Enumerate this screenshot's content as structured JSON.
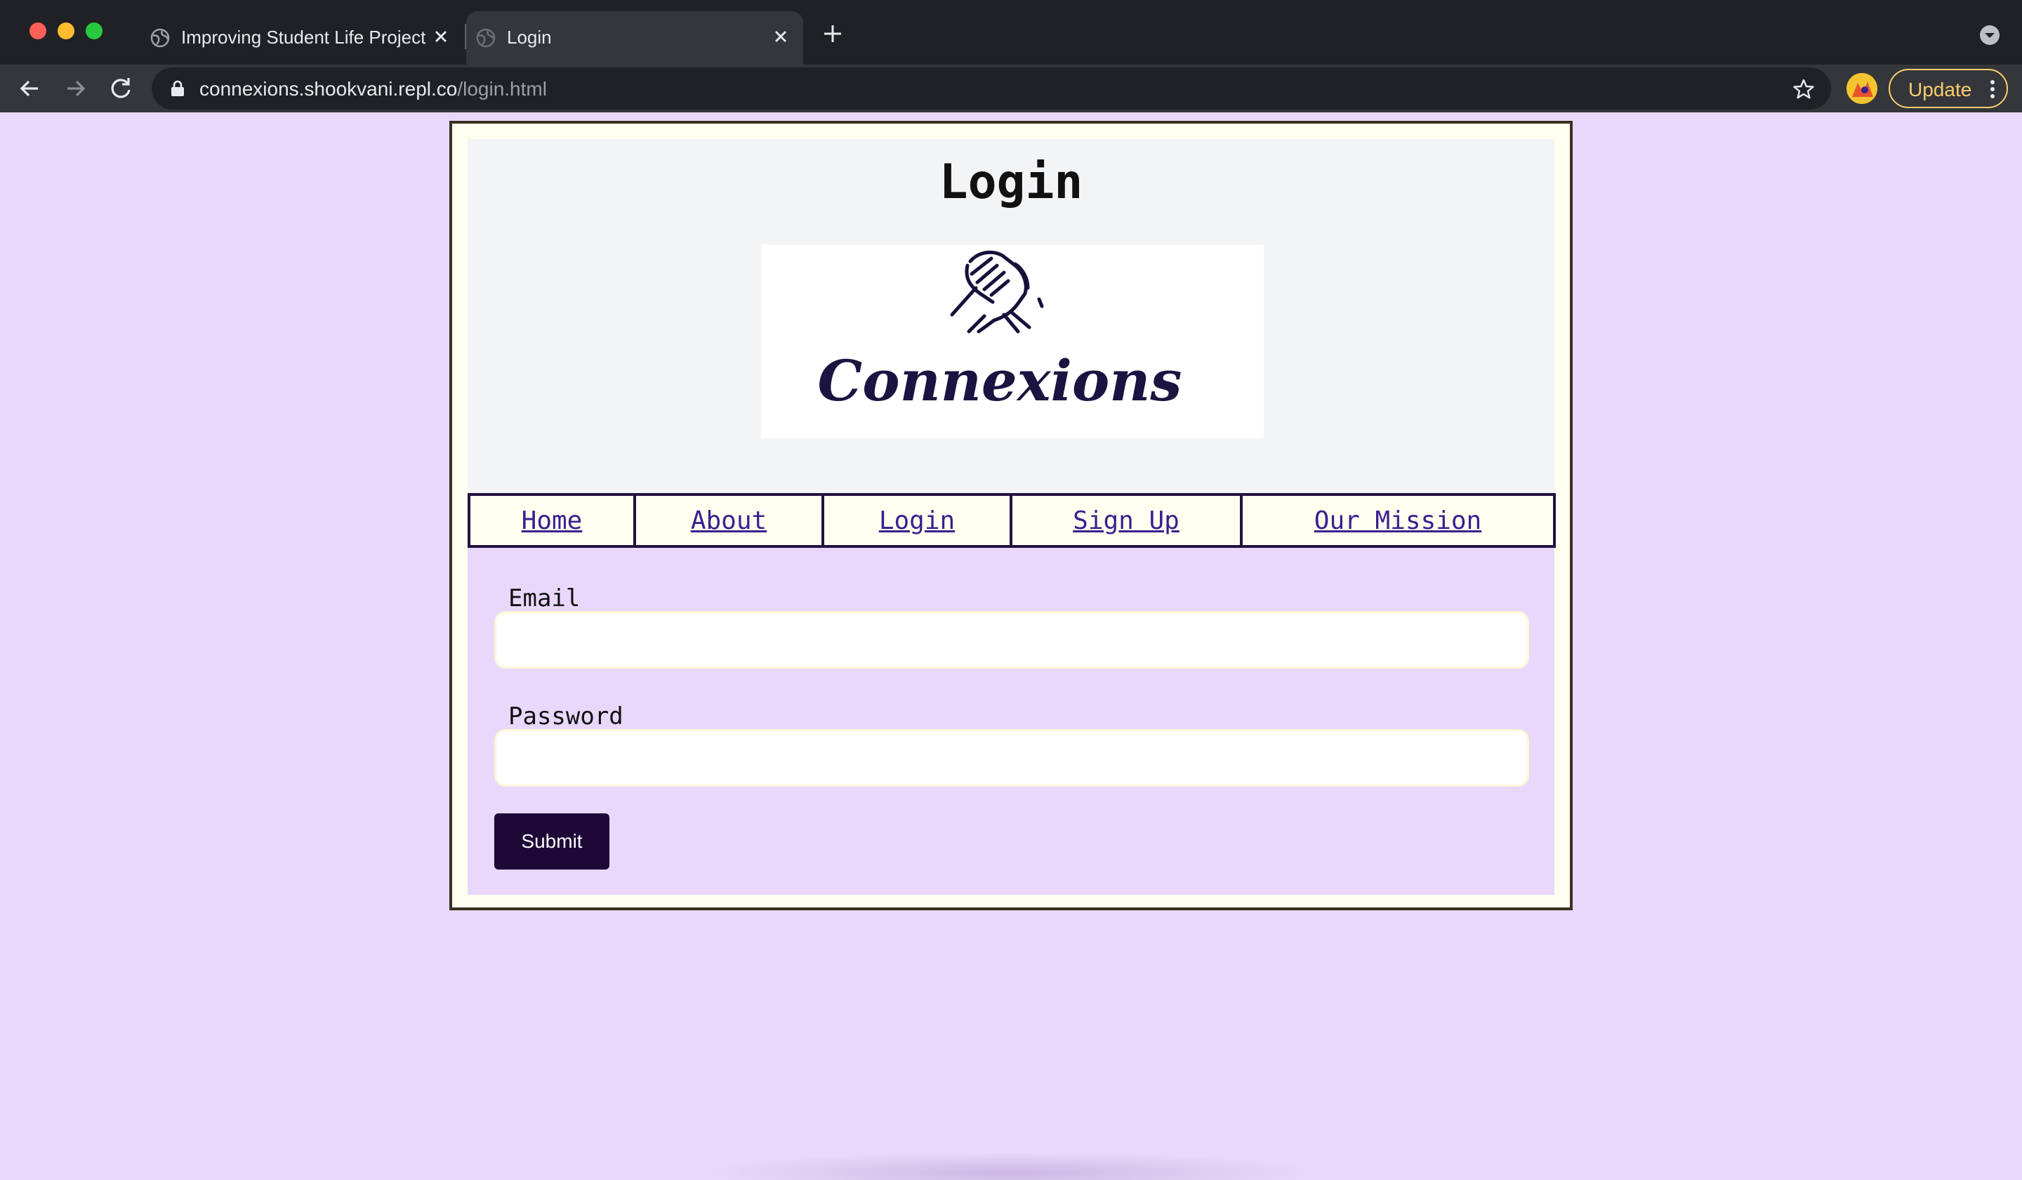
{
  "browser": {
    "tabs": [
      {
        "title": "Improving Student Life Project",
        "active": false
      },
      {
        "title": "Login",
        "active": true
      }
    ],
    "url": {
      "host": "connexions.shookvani.repl.co",
      "path": "/login.html"
    },
    "update_label": "Update",
    "icons": [
      "back-icon",
      "forward-icon",
      "reload-icon",
      "lock-icon",
      "star-icon",
      "new-tab-icon",
      "tab-list-icon",
      "more-icon",
      "globe-icon",
      "close-icon"
    ]
  },
  "page": {
    "title": "Login",
    "logo_text": "Connexions",
    "nav": [
      {
        "label": "Home"
      },
      {
        "label": "About"
      },
      {
        "label": "Login"
      },
      {
        "label": "Sign Up"
      },
      {
        "label": "Our Mission"
      }
    ],
    "form": {
      "email_label": "Email",
      "email_value": "",
      "password_label": "Password",
      "password_value": "",
      "submit_label": "Submit"
    }
  },
  "colors": {
    "page_background": "#e9d8fb",
    "frame_border": "#3a3023",
    "nav_border": "#23123f",
    "link": "#3b1f8f",
    "submit_bg": "#1e0838",
    "update_accent": "#f9ce6f"
  }
}
